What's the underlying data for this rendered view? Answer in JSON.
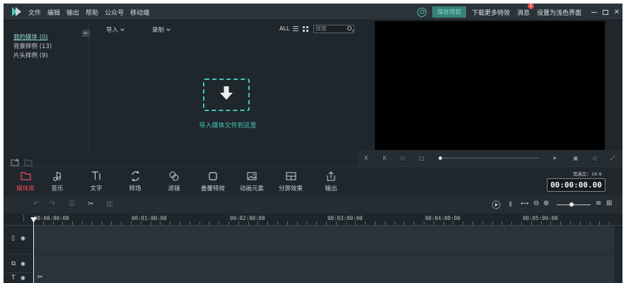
{
  "app": {
    "menu": [
      "文件",
      "编辑",
      "输出",
      "帮助",
      "公众号",
      "移动端"
    ],
    "titlebar": {
      "save_project": "保存项目",
      "download_effects": "下载更多特效",
      "messages": "消息",
      "messages_badge": "1",
      "set_light_ui": "设置为浅色界面"
    }
  },
  "library": {
    "sidebar": [
      {
        "label": "我的媒体 (0)",
        "active": true
      },
      {
        "label": "背景样例 (13)",
        "active": false
      },
      {
        "label": "片头样例 (9)",
        "active": false
      }
    ],
    "toolbar": {
      "import": "导入",
      "record": "录制",
      "all": "ALL",
      "search_placeholder": "搜索"
    },
    "import_hint": "导入媒体文件到这里"
  },
  "tools": [
    {
      "label": "媒体库",
      "icon": "folder-icon",
      "active": true
    },
    {
      "label": "音乐",
      "icon": "music-note-icon",
      "active": false
    },
    {
      "label": "文字",
      "icon": "text-icon",
      "active": false
    },
    {
      "label": "转场",
      "icon": "transition-icon",
      "active": false
    },
    {
      "label": "滤镜",
      "icon": "filter-icon",
      "active": false
    },
    {
      "label": "叠覆特效",
      "icon": "overlay-icon",
      "active": false
    },
    {
      "label": "动画元素",
      "icon": "element-icon",
      "active": false
    },
    {
      "label": "分屏效果",
      "icon": "split-screen-icon",
      "active": false
    },
    {
      "label": "输出",
      "icon": "export-icon",
      "active": false
    }
  ],
  "preview": {
    "aspect_ratio": "宽高比：16:9",
    "timecode": "00:00:00.00"
  },
  "timeline": {
    "ruler": [
      "00:00:00:00",
      "00:01:00:00",
      "00:02:00:00",
      "00:03:00:00",
      "00:04:00:00",
      "00:05:00:00"
    ]
  },
  "colors": {
    "accent_teal": "#3fc9b9",
    "active_red": "#ef4b5b",
    "bg_dark": "#1f262c"
  }
}
